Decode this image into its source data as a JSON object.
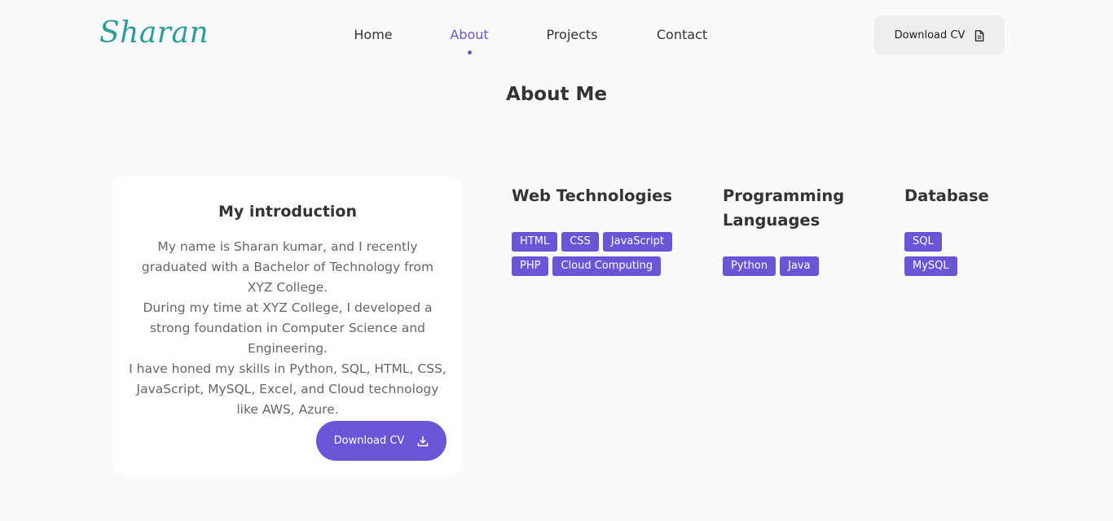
{
  "logo": "Sharan",
  "nav": {
    "items": [
      "Home",
      "About",
      "Projects",
      "Contact"
    ],
    "active": "About",
    "cv_label": "Download CV"
  },
  "page_title": "About Me",
  "intro": {
    "title": "My introduction",
    "lines": [
      "My name is Sharan kumar, and I recently graduated with a Bachelor of Technology from XYZ College.",
      "During my time at XYZ College, I developed a strong foundation in Computer Science and Engineering.",
      "I have honed my skills in Python, SQL, HTML, CSS, JavaScript, MySQL, Excel, and Cloud technology like AWS, Azure."
    ],
    "button_label": "Download CV"
  },
  "skills": [
    {
      "title": "Web Technologies",
      "tags": [
        "HTML",
        "CSS",
        "JavaScript",
        "PHP",
        "Cloud Computing"
      ]
    },
    {
      "title": "Programming Languages",
      "tags": [
        "Python",
        "Java"
      ]
    },
    {
      "title": "Database",
      "tags": [
        "SQL",
        "MySQL"
      ]
    }
  ],
  "colors": {
    "accent": "#6a55d6",
    "logo": "#2a9d9a",
    "background": "#fafafa"
  },
  "icons": {
    "top_cv": "file-document-icon",
    "main_cv": "download-icon"
  }
}
